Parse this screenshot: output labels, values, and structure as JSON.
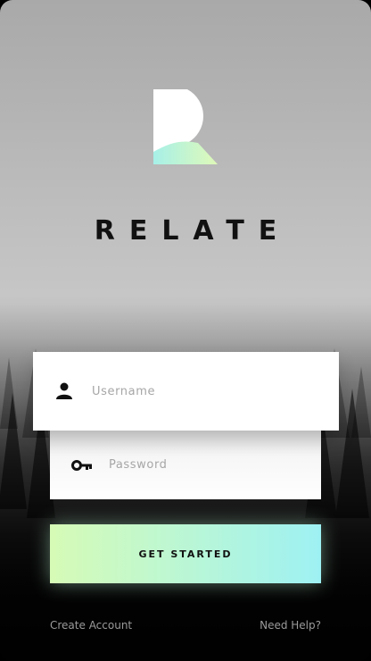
{
  "app": {
    "brand_name": "RELATE",
    "logo_icon": "relate-r-logo",
    "accent_gradient": [
      "#d6fbb6",
      "#9ef1f3"
    ]
  },
  "login_form": {
    "username": {
      "icon": "user-icon",
      "placeholder": "Username",
      "value": ""
    },
    "password": {
      "icon": "key-icon",
      "placeholder": "Password",
      "value": ""
    },
    "submit_label": "GET STARTED"
  },
  "footer": {
    "create_account_label": "Create Account",
    "help_label": "Need Help?"
  }
}
